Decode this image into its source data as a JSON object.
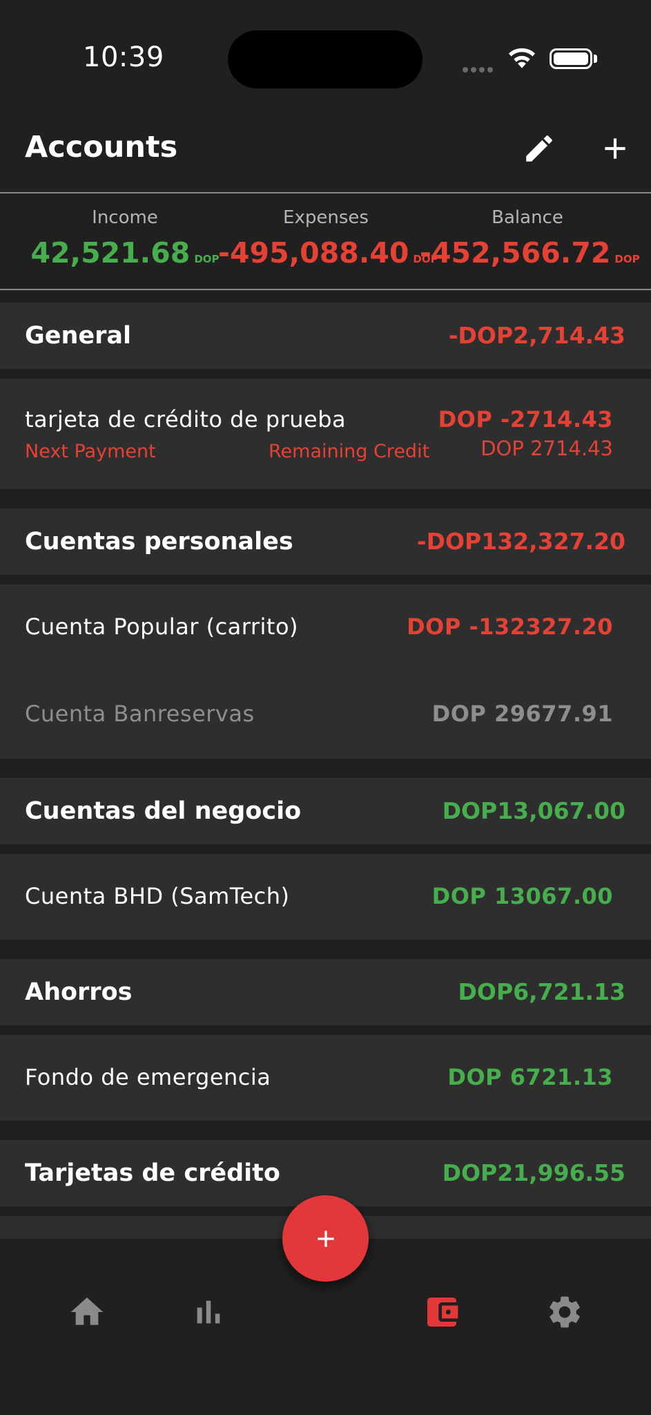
{
  "status_bar": {
    "time": "10:39"
  },
  "header": {
    "title": "Accounts"
  },
  "summary": {
    "income": {
      "label": "Income",
      "value": "42,521.68",
      "currency": "DOP"
    },
    "expenses": {
      "label": "Expenses",
      "value": "-495,088.40",
      "currency": "DOP"
    },
    "balance": {
      "label": "Balance",
      "value": "-452,566.72",
      "currency": "DOP"
    }
  },
  "groups": [
    {
      "name": "General",
      "total": "-DOP2,714.43",
      "accounts": [
        {
          "name": "tarjeta de crédito de prueba",
          "value": "DOP -2714.43",
          "next_payment_label": "Next Payment",
          "remaining_credit_label": "Remaining Credit",
          "remaining_credit_value": "DOP 2714.43"
        }
      ]
    },
    {
      "name": "Cuentas personales",
      "total": "-DOP132,327.20",
      "accounts": [
        {
          "name": "Cuenta Popular (carrito)",
          "value": "DOP -132327.20"
        },
        {
          "name": "Cuenta Banreservas",
          "value": "DOP 29677.91"
        }
      ]
    },
    {
      "name": "Cuentas del negocio",
      "total": "DOP13,067.00",
      "accounts": [
        {
          "name": "Cuenta BHD (SamTech)",
          "value": "DOP 13067.00"
        }
      ]
    },
    {
      "name": "Ahorros",
      "total": "DOP6,721.13",
      "accounts": [
        {
          "name": "Fondo de emergencia",
          "value": "DOP 6721.13"
        }
      ]
    },
    {
      "name": "Tarjetas de crédito",
      "total": "DOP21,996.55",
      "accounts": []
    }
  ],
  "nav": {
    "items": [
      {
        "icon": "home-icon"
      },
      {
        "icon": "bar-chart-icon"
      },
      {
        "icon": "wallet-icon",
        "active": true
      },
      {
        "icon": "gear-icon"
      }
    ]
  },
  "colors": {
    "positive": "#46ae4c",
    "negative": "#e54135",
    "muted": "#8e8e8e",
    "accent": "#e2383a",
    "background": "#202020",
    "card": "#2e2e2e"
  }
}
